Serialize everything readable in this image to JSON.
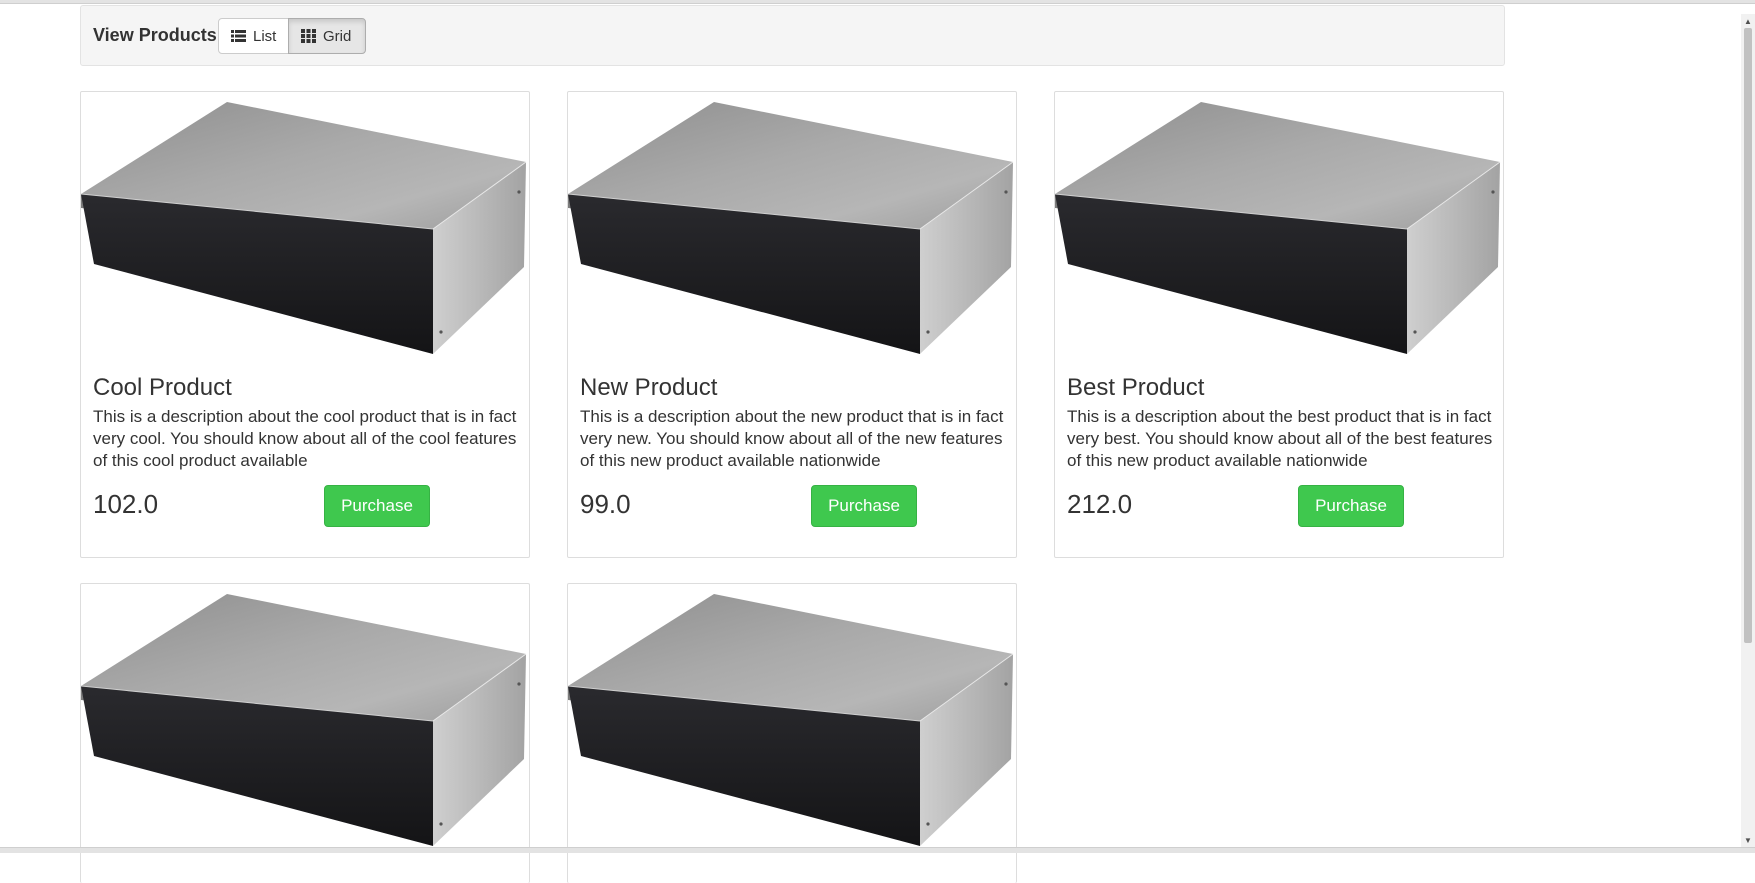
{
  "toolbar": {
    "title": "View Products",
    "list_label": "List",
    "grid_label": "Grid",
    "list_icon": "list-icon",
    "grid_icon": "grid-icon",
    "active_view": "Grid"
  },
  "products": [
    {
      "name": "Cool Product",
      "description": "This is a description about the cool product that is in fact very cool. You should know about all of the cool features of this cool product available",
      "price": "102.0",
      "button_label": "Purchase"
    },
    {
      "name": "New Product",
      "description": "This is a description about the new product that is in fact very new. You should know about all of the new features of this new product available nationwide",
      "price": "99.0",
      "button_label": "Purchase"
    },
    {
      "name": "Best Product",
      "description": "This is a description about the best product that is in fact very best. You should know about all of the best features of this new product available nationwide",
      "price": "212.0",
      "button_label": "Purchase"
    }
  ],
  "colors": {
    "purchase_button": "#3fc84e",
    "toolbar_bg": "#f5f5f5",
    "card_border": "#dddddd"
  }
}
